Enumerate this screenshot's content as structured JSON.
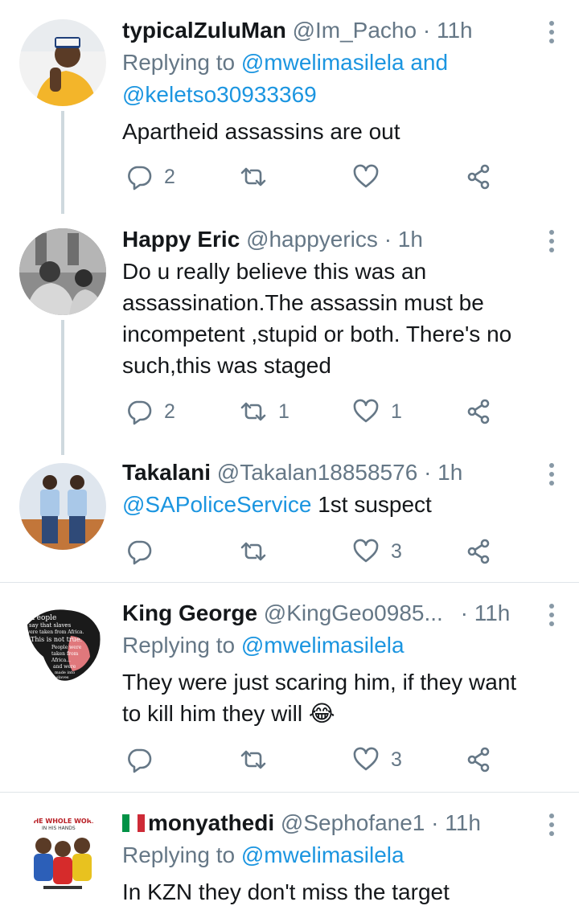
{
  "tweets": [
    {
      "name": "typicalZuluMan",
      "handle": "@Im_Pacho",
      "time": "· 11h",
      "replying_prefix": "Replying to",
      "replying_to_1": "@mwelimasilela",
      "replying_and": "and",
      "replying_to_2": "@keletso30933369",
      "text": "Apartheid assassins are out",
      "replies": "2",
      "retweets": "",
      "likes": ""
    },
    {
      "name": "Happy Eric",
      "handle": "@happyerics",
      "time": "· 1h",
      "text": "Do u really believe this was an assassination.The assassin must be incompetent ,stupid or both. There's no such,this was staged",
      "replies": "2",
      "retweets": "1",
      "likes": "1"
    },
    {
      "name": "Takalani",
      "handle": "@Takalan18858576",
      "time": "· 1h",
      "mention": "@SAPoliceService",
      "text": "1st suspect",
      "replies": "",
      "retweets": "",
      "likes": "3"
    },
    {
      "name": "King George",
      "handle": "@KingGeo0985...",
      "time": "· 11h",
      "replying_prefix": "Replying to",
      "replying_to_1": "@mwelimasilela",
      "text": "They were just scaring him, if they want to kill him they will 😂",
      "replies": "",
      "retweets": "",
      "likes": "3"
    },
    {
      "name": "monyathedi",
      "handle": "@Sephofane1",
      "time": "· 11h",
      "replying_prefix": "Replying to",
      "replying_to_1": "@mwelimasilela",
      "text": "In KZN they don't miss the target"
    }
  ],
  "avatar_art": {
    "kinggeorge_lines": [
      "People",
      "say that slaves",
      "were taken from Africa.",
      "This is not true.",
      "People were",
      "taken from",
      "Africa...",
      "and were",
      "made into",
      "slaves"
    ],
    "monyathedi_banner": "THE WHOLE WORLD",
    "monyathedi_banner2": "IN HIS HANDS"
  },
  "icons": [
    "reply-icon",
    "retweet-icon",
    "like-icon",
    "share-icon",
    "more-icon"
  ],
  "colors": {
    "link": "#1b95e0",
    "muted": "#657786",
    "text": "#14171a",
    "thread_line": "#cfd9de"
  }
}
